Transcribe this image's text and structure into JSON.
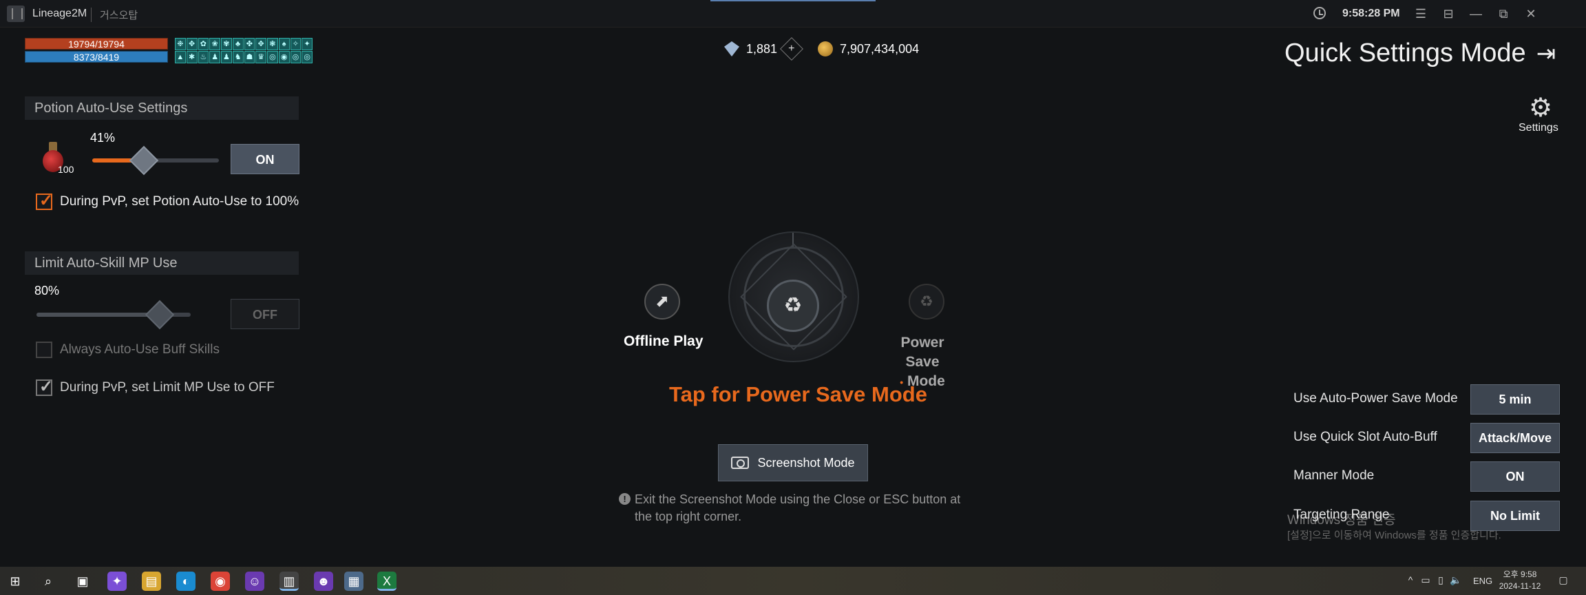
{
  "titlebar": {
    "app_title": "Lineage2M",
    "subtitle": "거스오탑",
    "clock": "9:58:28 PM",
    "buttons": [
      "☰",
      "⊟",
      "—",
      "⧉",
      "✕"
    ]
  },
  "status": {
    "hp": "19794/19794",
    "mp": "8373/8419",
    "buffs": [
      "❉",
      "✥",
      "✿",
      "❀",
      "✾",
      "♣",
      "✤",
      "✥",
      "❃",
      "♠",
      "✧",
      "✦",
      "▲",
      "✱",
      "♨",
      "♟",
      "♟",
      "♞",
      "☗",
      "♛",
      "◎",
      "◉",
      "◎",
      "◎"
    ]
  },
  "currency": {
    "gems": "1,881",
    "add": "+",
    "gold": "7,907,434,004"
  },
  "quick_settings": {
    "title": "Quick Settings Mode",
    "exit_icon": "⇥",
    "settings_label": "Settings",
    "settings_icon": "⚙"
  },
  "potion_panel": {
    "header": "Potion Auto-Use Settings",
    "count": "100",
    "percent": "41%",
    "level": 0.41,
    "toggle": "ON",
    "pvp_check_label": "During PvP, set Potion Auto-Use to 100%",
    "checkmark": "✓"
  },
  "mp_panel": {
    "header": "Limit Auto-Skill MP Use",
    "percent": "80%",
    "level": 0.8,
    "toggle": "OFF",
    "buff_check_label": "Always Auto-Use Buff Skills",
    "pvp_check_label": "During PvP, set Limit MP Use to OFF",
    "checkmark": "✓"
  },
  "center": {
    "offline_label": "Offline Play",
    "offline_icon": "⬈",
    "power_label_1": "Power Save",
    "power_dot": "•",
    "power_label_2": "Mode",
    "power_icon": "♻",
    "hub_icon": "♻",
    "cta": "Tap for Power Save Mode",
    "screenshot_btn": "Screenshot Mode",
    "info_icon": "!",
    "info_text": "Exit the Screenshot Mode using the Close or ESC button at the top right corner."
  },
  "right_settings": [
    {
      "label": "Use Auto-Power Save Mode",
      "value": "5 min"
    },
    {
      "label": "Use Quick Slot Auto-Buff",
      "value": "Attack/Move"
    },
    {
      "label": "Manner Mode",
      "value": "ON"
    },
    {
      "label": "Targeting Range",
      "value": "No Limit"
    }
  ],
  "watermark": {
    "line1": "Windows 정품 인증",
    "line2": "[설정]으로 이동하여 Windows를 정품 인증합니다."
  },
  "taskbar": {
    "apps": [
      "⊞",
      "⌕",
      "▣",
      "✦",
      "▤",
      "◐",
      "◉",
      "☺",
      "▥",
      "☻",
      "▦",
      "X"
    ],
    "lang": "ENG",
    "time": "오후 9:58",
    "date": "2024-11-12",
    "tray": [
      "^",
      "▭",
      "▯",
      "🔈",
      "▢"
    ]
  }
}
